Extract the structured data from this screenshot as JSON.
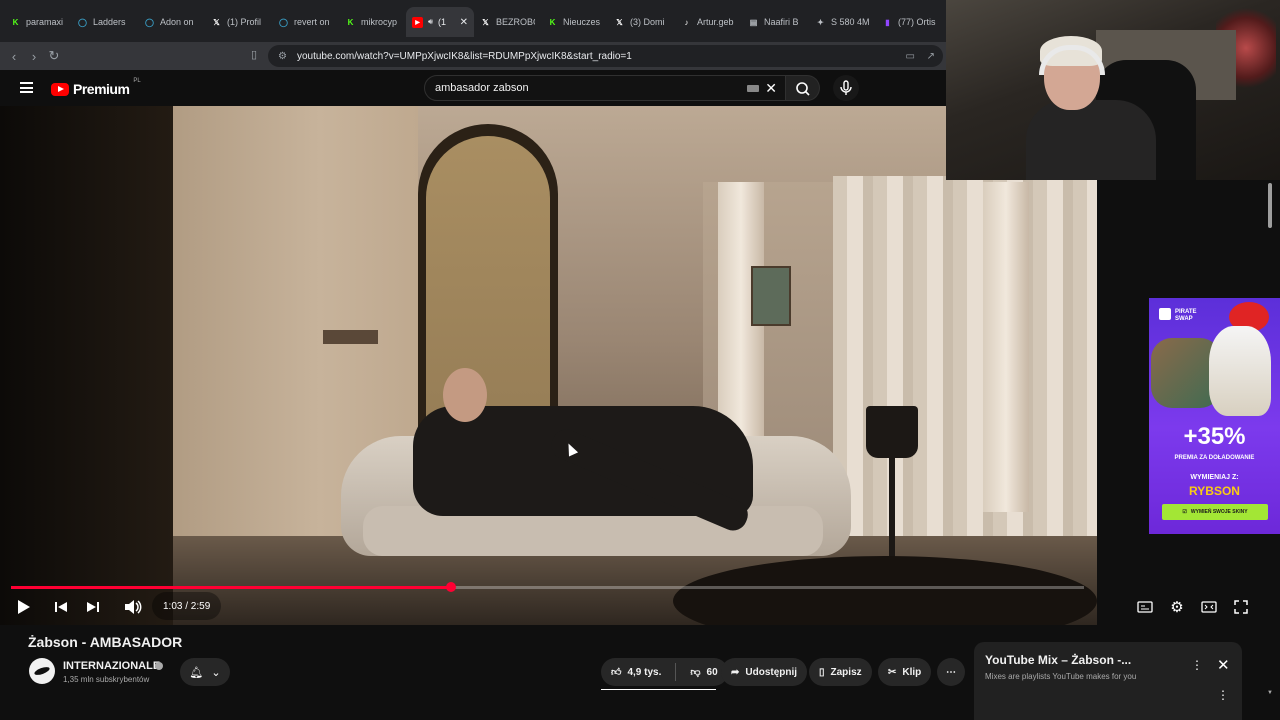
{
  "browser": {
    "tabs": [
      {
        "label": "paramaxi",
        "icon": "k-icon",
        "color": "#53fc18"
      },
      {
        "label": "Ladders",
        "icon": "ring-icon",
        "color": "#3aa0c8"
      },
      {
        "label": "Adon on",
        "icon": "ring-icon",
        "color": "#3aa0c8"
      },
      {
        "label": "(1) Profil",
        "icon": "x-icon",
        "color": "#ffffff"
      },
      {
        "label": "revert on",
        "icon": "ring-icon",
        "color": "#3aa0c8"
      },
      {
        "label": "mikrocyp",
        "icon": "k-icon",
        "color": "#53fc18"
      },
      {
        "label": "(1",
        "icon": "youtube-icon",
        "color": "#ff0000",
        "active": true
      },
      {
        "label": "BEZROBO",
        "icon": "x-icon",
        "color": "#ffffff"
      },
      {
        "label": "Nieuczes",
        "icon": "k-icon",
        "color": "#53fc18"
      },
      {
        "label": "(3) Domi",
        "icon": "x-icon",
        "color": "#ffffff"
      },
      {
        "label": "Artur.geb",
        "icon": "tiktok-icon",
        "color": "#ffffff"
      },
      {
        "label": "Naafiri B",
        "icon": "doc-icon",
        "color": "#bdc1c6"
      },
      {
        "label": "S 580 4M",
        "icon": "mercedes-icon",
        "color": "#bdc1c6"
      },
      {
        "label": "(77) Ortis",
        "icon": "twitch-icon",
        "color": "#9146ff"
      }
    ],
    "url": "youtube.com/watch?v=UMPpXjwcIK8&list=RDUMPpXjwcIK8&start_radio=1"
  },
  "youtube": {
    "brand": "Premium",
    "region": "PL",
    "search_query": "ambasador zabson"
  },
  "player": {
    "time": "1:03 / 2:59",
    "progress_fraction": 0.41
  },
  "video": {
    "title": "Żabson - AMBASADOR",
    "channel": "INTERNAZIONALE",
    "subscribers": "1,35 mln subskrybentów",
    "likes": "4,9 tys.",
    "dislikes": "60",
    "share_label": "Udostępnij",
    "save_label": "Zapisz",
    "clip_label": "Klip"
  },
  "mix": {
    "title": "YouTube Mix – Żabson -...",
    "subtitle": "Mixes are playlists YouTube makes for you"
  },
  "ad": {
    "brand": "PIRATE SWAP",
    "headline": "+35%",
    "sub": "PREMIA ZA DOŁADOWANIE",
    "exchange": "WYMIENIAJ Z:",
    "partner": "RYBSON",
    "cta": "WYMIEŃ SWOJE SKINY"
  }
}
